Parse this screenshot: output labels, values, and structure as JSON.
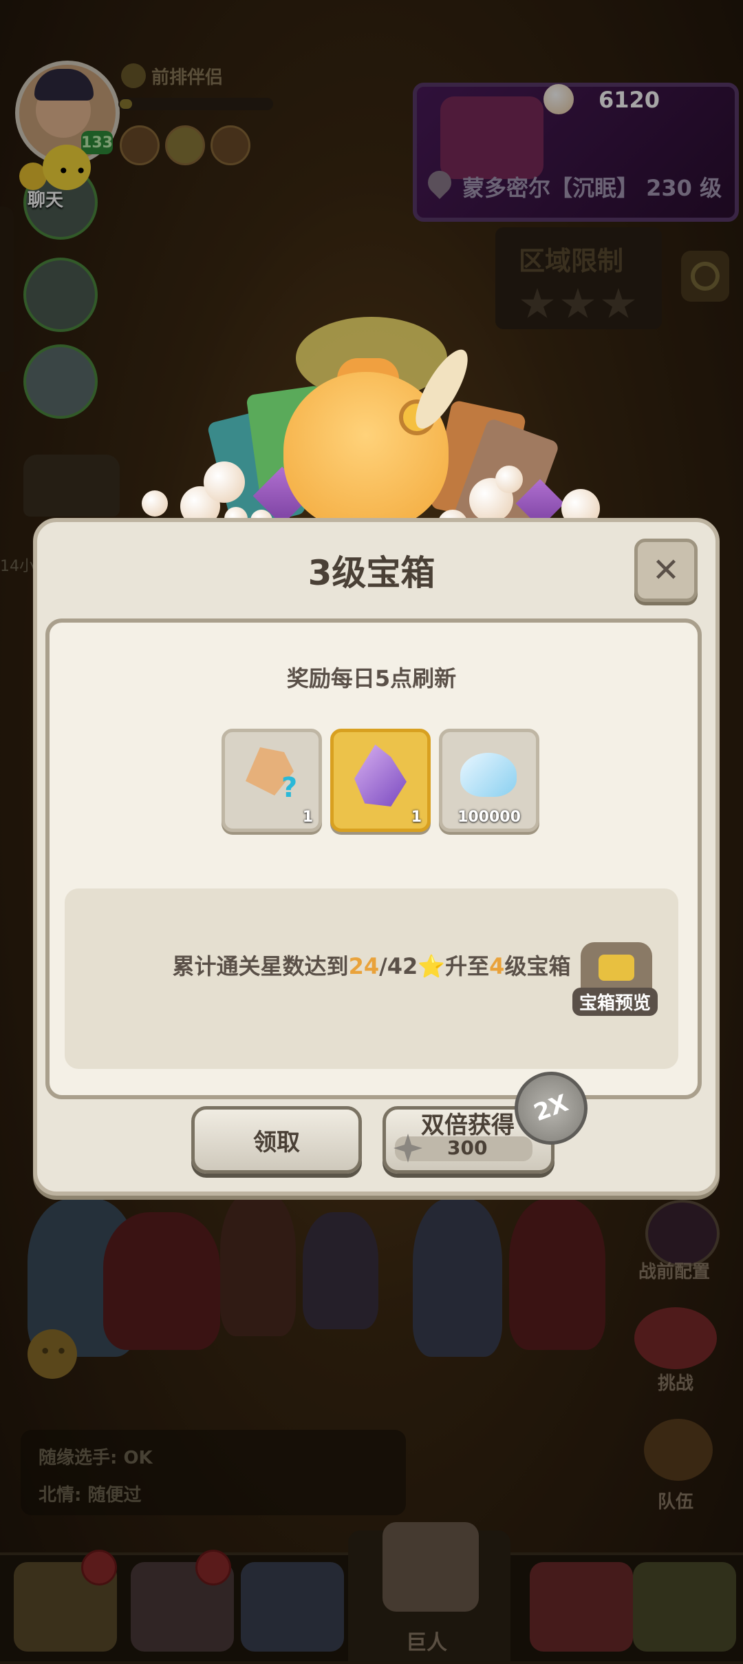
{
  "player": {
    "level": "133",
    "partner_label": "前排伴侣"
  },
  "chat": {
    "label": "聊天",
    "messages": [
      {
        "text": "随缘选手: OK"
      },
      {
        "text": "北情: 随便过"
      }
    ]
  },
  "boss_panel": {
    "currency_count": "6120",
    "location_text": "蒙多密尔【沉眠】 230 级"
  },
  "region_limit": {
    "label": "区域限制",
    "stars": 3
  },
  "left_partial_text": "14小",
  "dialog": {
    "title": "3级宝箱",
    "close_symbol": "✕",
    "subtitle": "奖励每日5点刷新",
    "rewards": [
      {
        "icon": "mystery-crystal-icon",
        "count": "1"
      },
      {
        "icon": "purple-crystal-icon",
        "count": "1",
        "highlighted": true
      },
      {
        "icon": "pearl-shell-icon",
        "count": "100000"
      }
    ],
    "progress": {
      "prefix": "累计通关星数达到",
      "current": "24",
      "separator": "/",
      "total": "42",
      "star_glyph": "⭐",
      "mid": "升至",
      "target_level": "4",
      "suffix": "级宝箱"
    },
    "preview_label": "宝箱预览",
    "claim_button": "领取",
    "double_button": {
      "label": "双倍获得",
      "cost": "300",
      "badge": "2X"
    }
  },
  "side_menu": {
    "prebattle_config": "战前配置",
    "challenge": "挑战",
    "team": "队伍"
  },
  "bottom_nav": {
    "active_label": "巨人"
  }
}
